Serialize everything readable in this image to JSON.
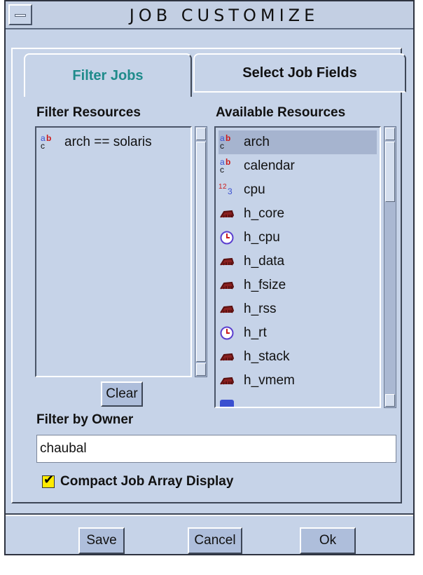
{
  "window": {
    "title": "JOB CUSTOMIZE"
  },
  "tabs": [
    {
      "label": "Filter Jobs",
      "active": true
    },
    {
      "label": "Select Job Fields",
      "active": false
    }
  ],
  "filter_resources": {
    "label": "Filter Resources",
    "items": [
      {
        "icon": "string-type-icon",
        "text": "arch == solaris"
      }
    ],
    "clear_label": "Clear"
  },
  "available_resources": {
    "label": "Available Resources",
    "items": [
      {
        "icon": "string-type-icon",
        "text": "arch",
        "selected": true
      },
      {
        "icon": "string-type-icon",
        "text": "calendar"
      },
      {
        "icon": "number-type-icon",
        "text": "cpu"
      },
      {
        "icon": "memory-type-icon",
        "text": "h_core"
      },
      {
        "icon": "time-type-icon",
        "text": "h_cpu"
      },
      {
        "icon": "memory-type-icon",
        "text": "h_data"
      },
      {
        "icon": "memory-type-icon",
        "text": "h_fsize"
      },
      {
        "icon": "memory-type-icon",
        "text": "h_rss"
      },
      {
        "icon": "time-type-icon",
        "text": "h_rt"
      },
      {
        "icon": "memory-type-icon",
        "text": "h_stack"
      },
      {
        "icon": "memory-type-icon",
        "text": "h_vmem"
      }
    ]
  },
  "owner_filter": {
    "label": "Filter by Owner",
    "value": "chaubal"
  },
  "compact_array": {
    "label": "Compact Job Array Display",
    "checked": true
  },
  "footer": {
    "save_label": "Save",
    "cancel_label": "Cancel",
    "ok_label": "Ok"
  },
  "colors": {
    "background": "#c6d3e8",
    "active_tab_text": "#1f8b8b",
    "button": "#aebedb",
    "selection": "#a6b4cf",
    "checkbox": "#ffeb00"
  }
}
